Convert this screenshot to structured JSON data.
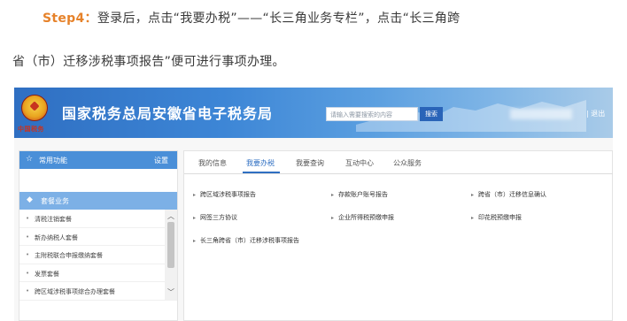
{
  "intro": {
    "step_label": "Step4：",
    "line1_text": "登录后，点击“我要办税”——“长三角业务专栏”，点击“长三角跨",
    "line2_text": "省（市）迁移涉税事项报告”便可进行事项办理。"
  },
  "screenshot": {
    "header": {
      "emblem_caption": "中国税务",
      "site_title": "国家税务总局安徽省电子税务局",
      "search_placeholder": "请输入需要搜索的内容",
      "search_button": "搜索",
      "logout_label": "| 退出"
    },
    "sidebar": {
      "common_label": "常用功能",
      "settings_label": "设置",
      "package_label": "套餐业务",
      "items": [
        {
          "label": "清税注销套餐"
        },
        {
          "label": "新办纳税人套餐"
        },
        {
          "label": "主附税联合申报缴纳套餐"
        },
        {
          "label": "发票套餐"
        },
        {
          "label": "跨区域涉税事项综合办理套餐"
        }
      ]
    },
    "tabs": [
      {
        "label": "我的信息"
      },
      {
        "label": "我要办税"
      },
      {
        "label": "我要查询"
      },
      {
        "label": "互动中心"
      },
      {
        "label": "公众服务"
      }
    ],
    "active_tab": "我要办税",
    "services": {
      "row1": [
        "跨区域涉税事项报告",
        "存款账户账号报告",
        "跨省（市）迁移信息确认"
      ],
      "row2": [
        "网签三方协议",
        "企业所得税预缴申报",
        "印花税预缴申报"
      ],
      "row3": [
        "长三角跨省（市）迁移涉税事项报告"
      ]
    }
  },
  "colors": {
    "accent": "#2f6fc2",
    "step": "#e6822a",
    "sidebar_head": "#4a8fd8",
    "sidebar_sub": "#7cb0e6"
  }
}
